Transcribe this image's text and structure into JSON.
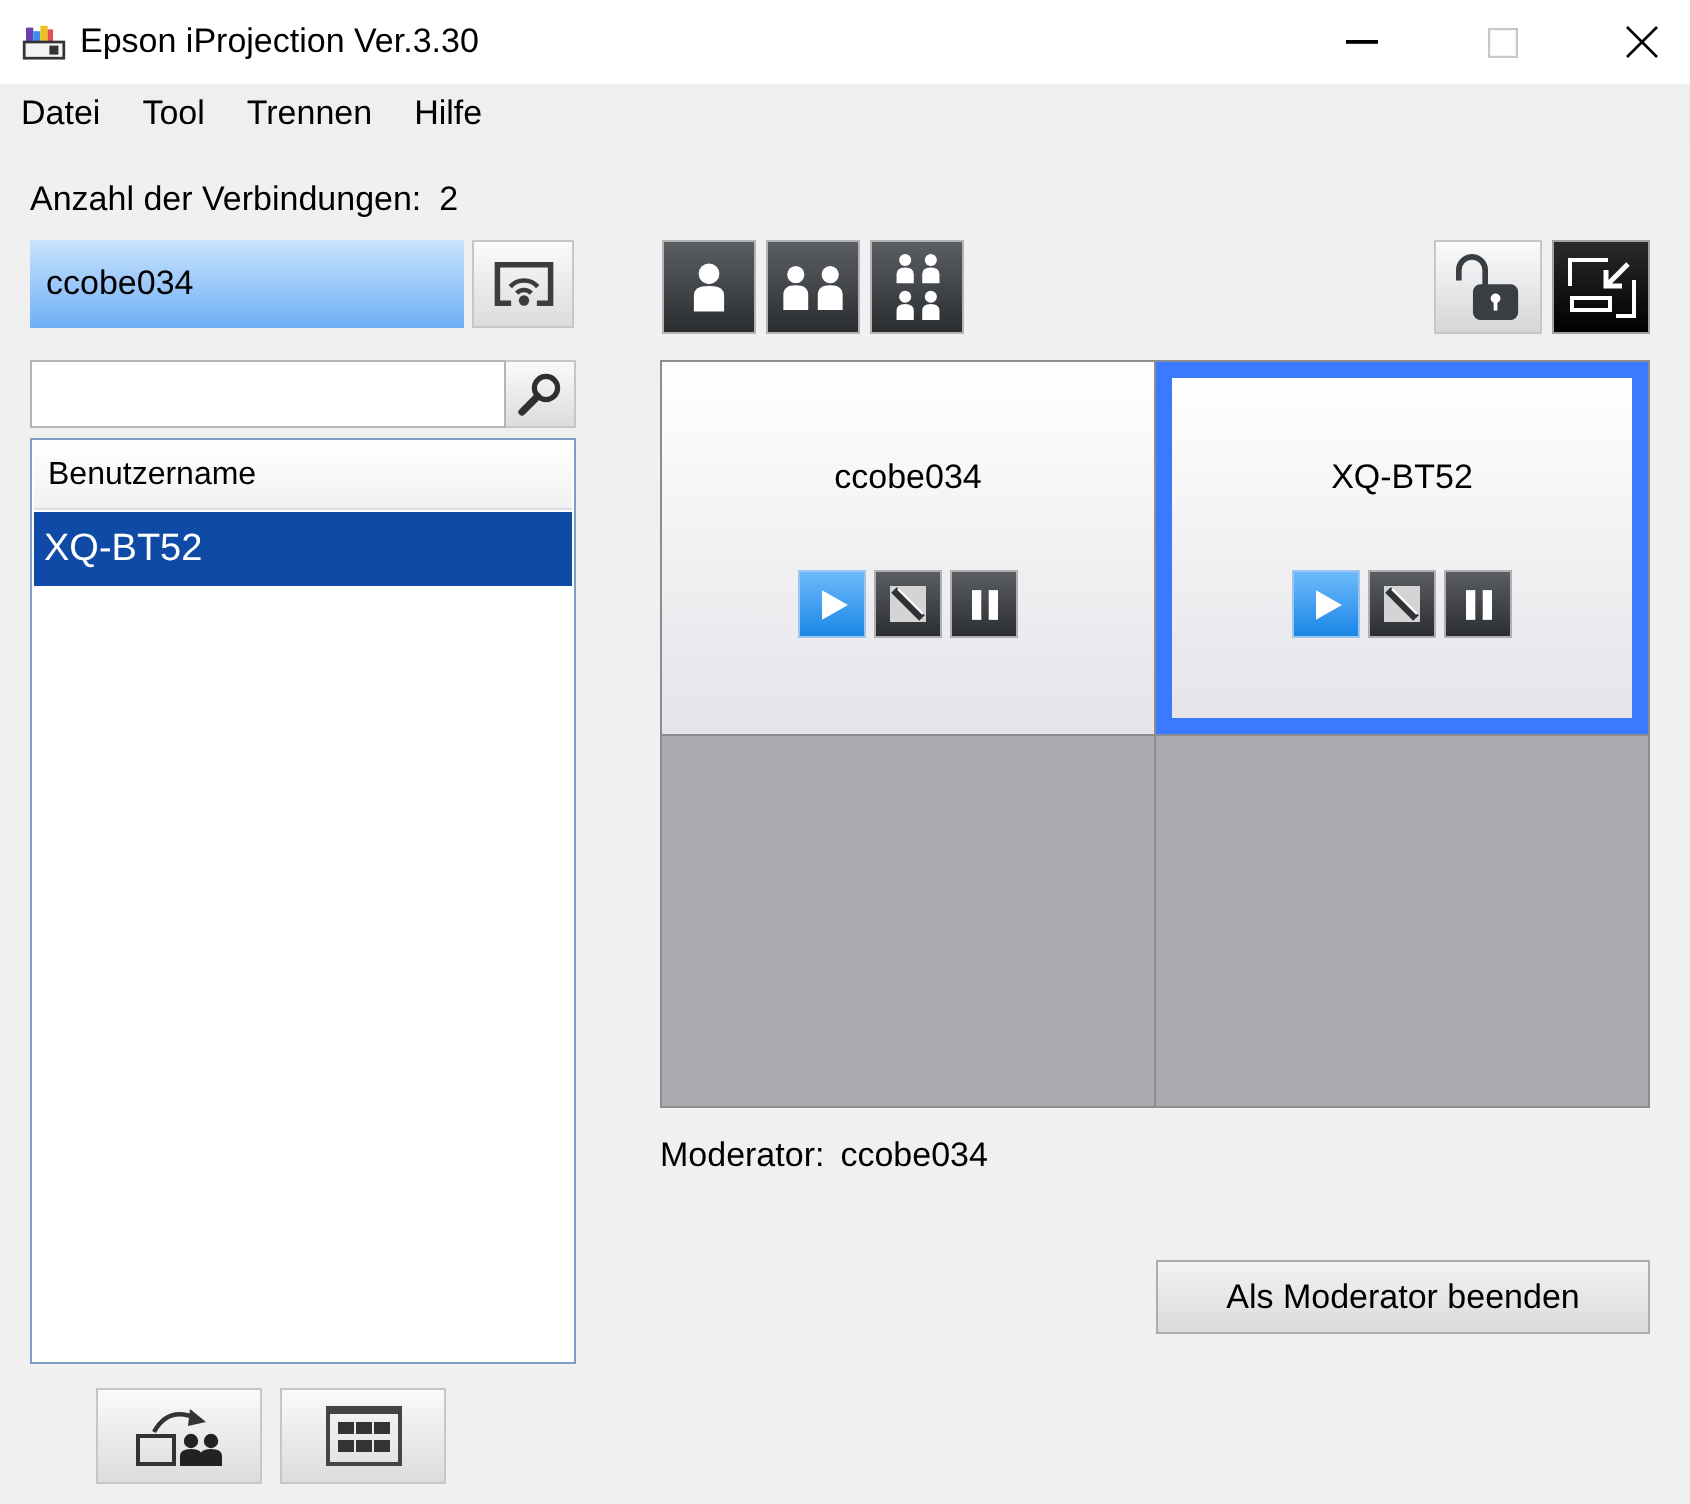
{
  "window": {
    "title": "Epson iProjection Ver.3.30",
    "controls": [
      {
        "kind": "minimize",
        "disabled": false
      },
      {
        "kind": "maximize",
        "disabled": true
      },
      {
        "kind": "close",
        "disabled": false
      }
    ]
  },
  "menu": [
    "Datei",
    "Tool",
    "Trennen",
    "Hilfe"
  ],
  "connections": {
    "label": "Anzahl der Verbindungen:",
    "count": "2"
  },
  "current_user": {
    "name": "ccobe034"
  },
  "user_list": {
    "columns": [
      "Benutzername"
    ],
    "rows": [
      {
        "name": "XQ-BT52",
        "selected": true
      }
    ]
  },
  "layout_buttons": [
    {
      "kind": "single"
    },
    {
      "kind": "double"
    },
    {
      "kind": "quad"
    }
  ],
  "lock": {
    "locked": false
  },
  "panels": [
    {
      "kind": "user",
      "name": "ccobe034",
      "selected": false,
      "controls": [
        {
          "kind": "play",
          "active": true
        },
        {
          "kind": "stop",
          "active": false
        },
        {
          "kind": "pause",
          "active": false
        }
      ]
    },
    {
      "kind": "user",
      "name": "XQ-BT52",
      "selected": true,
      "controls": [
        {
          "kind": "play",
          "active": true
        },
        {
          "kind": "stop",
          "active": false
        },
        {
          "kind": "pause",
          "active": false
        }
      ]
    },
    {
      "kind": "empty"
    },
    {
      "kind": "empty"
    }
  ],
  "moderator": {
    "label": "Moderator:",
    "name": "ccobe034"
  },
  "end_button": {
    "label": "Als Moderator beenden"
  },
  "bottom_buttons": [
    {
      "kind": "handover"
    },
    {
      "kind": "thumbnails"
    }
  ]
}
